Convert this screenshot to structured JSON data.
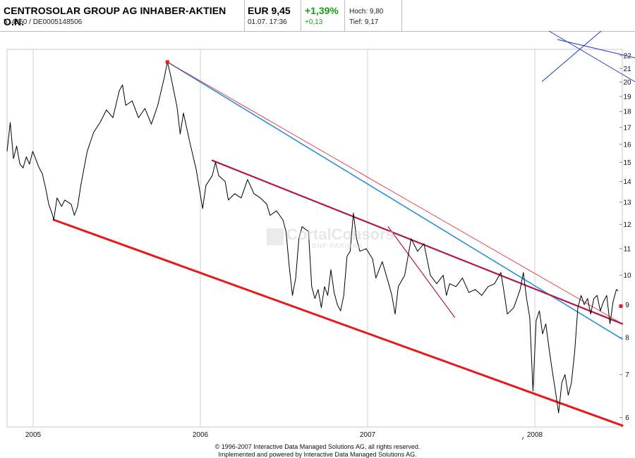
{
  "header": {
    "name": "CENTROSOLAR GROUP AG INHABER-AKTIEN O.N.",
    "ids": "514850  /  DE0005148506",
    "price": "EUR 9,45",
    "time": "01.07.  17:36",
    "change_pct": "+1,39%",
    "change_abs": "+0,13",
    "high": "Hoch: 9,80",
    "low": "Tief: 9,17"
  },
  "watermark": {
    "line1": "CortalConsors",
    "line2": "BNP PARIBAS"
  },
  "footer": {
    "line1": "© 1996-2007 Interactive Data Managed Solutions AG, all rights reserved.",
    "line2": "Implemented and powered by Interactive Data Managed Solutions AG."
  },
  "colors": {
    "price": "#000000",
    "trend_red": "#e8191b",
    "trend_blue": "#2c8ee0",
    "trend_darkred": "#b0184c",
    "corner_blue": "#1c2fd0",
    "positive": "#1a9a1a"
  },
  "chart_data": {
    "type": "line",
    "title": "",
    "xlabel": "",
    "ylabel": "",
    "y_scale": "log",
    "ylim": [
      5.8,
      22.5
    ],
    "xlim": [
      "2004-11-05",
      "2008-07-10"
    ],
    "y_ticks": [
      6,
      7,
      8,
      9,
      10,
      11,
      12,
      13,
      14,
      15,
      16,
      17,
      18,
      19,
      20,
      21,
      22
    ],
    "x_ticks": [
      {
        "date": "2005-01-01",
        "label": "2005"
      },
      {
        "date": "2006-01-01",
        "label": "2006"
      },
      {
        "date": "2007-01-01",
        "label": "2007"
      },
      {
        "date": "2008-01-01",
        "label": "2008"
      }
    ],
    "grid": "vertical",
    "series": [
      {
        "kind": "price",
        "points": [
          [
            "2004-11-05",
            15.6
          ],
          [
            "2004-11-12",
            17.3
          ],
          [
            "2004-11-19",
            15.2
          ],
          [
            "2004-11-26",
            15.9
          ],
          [
            "2004-12-03",
            14.9
          ],
          [
            "2004-12-10",
            14.7
          ],
          [
            "2004-12-17",
            15.3
          ],
          [
            "2004-12-24",
            14.9
          ],
          [
            "2004-12-31",
            15.6
          ],
          [
            "2005-01-14",
            14.7
          ],
          [
            "2005-01-21",
            14.4
          ],
          [
            "2005-01-28",
            13.7
          ],
          [
            "2005-02-04",
            12.9
          ],
          [
            "2005-02-11",
            12.5
          ],
          [
            "2005-02-15",
            12.2
          ],
          [
            "2005-02-22",
            13.2
          ],
          [
            "2005-03-04",
            12.8
          ],
          [
            "2005-03-11",
            13.1
          ],
          [
            "2005-03-25",
            12.9
          ],
          [
            "2005-04-01",
            12.4
          ],
          [
            "2005-04-08",
            12.8
          ],
          [
            "2005-04-15",
            13.8
          ],
          [
            "2005-04-29",
            15.6
          ],
          [
            "2005-05-13",
            16.7
          ],
          [
            "2005-05-27",
            17.3
          ],
          [
            "2005-06-10",
            18.1
          ],
          [
            "2005-06-24",
            17.6
          ],
          [
            "2005-07-08",
            19.4
          ],
          [
            "2005-07-15",
            19.8
          ],
          [
            "2005-07-22",
            18.4
          ],
          [
            "2005-08-05",
            18.7
          ],
          [
            "2005-08-19",
            17.6
          ],
          [
            "2005-09-02",
            18.2
          ],
          [
            "2005-09-16",
            17.2
          ],
          [
            "2005-09-30",
            18.4
          ],
          [
            "2005-10-14",
            20.3
          ],
          [
            "2005-10-21",
            21.5
          ],
          [
            "2005-10-28",
            20.5
          ],
          [
            "2005-11-11",
            18.3
          ],
          [
            "2005-11-18",
            16.6
          ],
          [
            "2005-11-25",
            17.9
          ],
          [
            "2005-12-09",
            16.1
          ],
          [
            "2005-12-23",
            14.6
          ],
          [
            "2006-01-06",
            12.7
          ],
          [
            "2006-01-13",
            13.8
          ],
          [
            "2006-01-27",
            14.3
          ],
          [
            "2006-02-03",
            15.0
          ],
          [
            "2006-02-10",
            14.3
          ],
          [
            "2006-02-24",
            14.0
          ],
          [
            "2006-03-03",
            13.1
          ],
          [
            "2006-03-17",
            13.4
          ],
          [
            "2006-03-31",
            13.2
          ],
          [
            "2006-04-14",
            14.1
          ],
          [
            "2006-04-28",
            13.4
          ],
          [
            "2006-05-12",
            13.2
          ],
          [
            "2006-05-26",
            12.9
          ],
          [
            "2006-06-02",
            12.4
          ],
          [
            "2006-06-16",
            12.6
          ],
          [
            "2006-06-30",
            12.2
          ],
          [
            "2006-07-07",
            11.7
          ],
          [
            "2006-07-14",
            10.3
          ],
          [
            "2006-07-21",
            9.3
          ],
          [
            "2006-07-28",
            9.9
          ],
          [
            "2006-08-04",
            11.4
          ],
          [
            "2006-08-11",
            11.9
          ],
          [
            "2006-08-25",
            11.7
          ],
          [
            "2006-09-01",
            9.6
          ],
          [
            "2006-09-08",
            9.2
          ],
          [
            "2006-09-15",
            9.5
          ],
          [
            "2006-09-22",
            8.9
          ],
          [
            "2006-09-29",
            9.6
          ],
          [
            "2006-10-06",
            9.3
          ],
          [
            "2006-10-13",
            10.2
          ],
          [
            "2006-10-20",
            9.4
          ],
          [
            "2006-10-27",
            9.0
          ],
          [
            "2006-11-03",
            8.8
          ],
          [
            "2006-11-10",
            9.3
          ],
          [
            "2006-11-17",
            10.7
          ],
          [
            "2006-11-24",
            10.9
          ],
          [
            "2006-12-01",
            12.5
          ],
          [
            "2006-12-08",
            11.4
          ],
          [
            "2006-12-15",
            10.9
          ],
          [
            "2006-12-29",
            11.0
          ],
          [
            "2007-01-12",
            10.6
          ],
          [
            "2007-01-19",
            9.9
          ],
          [
            "2007-02-02",
            10.5
          ],
          [
            "2007-02-16",
            9.7
          ],
          [
            "2007-02-23",
            9.3
          ],
          [
            "2007-03-02",
            8.7
          ],
          [
            "2007-03-09",
            9.6
          ],
          [
            "2007-03-23",
            10.0
          ],
          [
            "2007-04-06",
            11.4
          ],
          [
            "2007-04-20",
            10.9
          ],
          [
            "2007-05-04",
            11.2
          ],
          [
            "2007-05-18",
            10.0
          ],
          [
            "2007-06-01",
            9.7
          ],
          [
            "2007-06-15",
            10.0
          ],
          [
            "2007-06-22",
            9.3
          ],
          [
            "2007-06-29",
            9.7
          ],
          [
            "2007-07-13",
            9.6
          ],
          [
            "2007-07-27",
            9.9
          ],
          [
            "2007-08-10",
            9.4
          ],
          [
            "2007-08-24",
            9.5
          ],
          [
            "2007-09-07",
            9.3
          ],
          [
            "2007-09-21",
            9.6
          ],
          [
            "2007-10-05",
            9.7
          ],
          [
            "2007-10-19",
            10.1
          ],
          [
            "2007-10-26",
            9.4
          ],
          [
            "2007-11-02",
            8.7
          ],
          [
            "2007-11-16",
            8.9
          ],
          [
            "2007-11-30",
            9.5
          ],
          [
            "2007-12-07",
            10.1
          ],
          [
            "2007-12-14",
            9.2
          ],
          [
            "2007-12-21",
            8.6
          ],
          [
            "2007-12-28",
            6.6
          ],
          [
            "2008-01-04",
            8.5
          ],
          [
            "2008-01-11",
            8.8
          ],
          [
            "2008-01-18",
            8.1
          ],
          [
            "2008-01-25",
            8.4
          ],
          [
            "2008-02-01",
            7.7
          ],
          [
            "2008-02-08",
            7.1
          ],
          [
            "2008-02-15",
            6.6
          ],
          [
            "2008-02-22",
            6.1
          ],
          [
            "2008-02-29",
            6.8
          ],
          [
            "2008-03-07",
            7.0
          ],
          [
            "2008-03-14",
            6.5
          ],
          [
            "2008-03-21",
            6.8
          ],
          [
            "2008-03-28",
            7.6
          ],
          [
            "2008-04-04",
            8.9
          ],
          [
            "2008-04-11",
            9.3
          ],
          [
            "2008-04-18",
            9.0
          ],
          [
            "2008-04-25",
            9.2
          ],
          [
            "2008-05-02",
            8.7
          ],
          [
            "2008-05-09",
            9.2
          ],
          [
            "2008-05-16",
            9.3
          ],
          [
            "2008-05-23",
            8.8
          ],
          [
            "2008-05-30",
            9.1
          ],
          [
            "2008-06-06",
            9.3
          ],
          [
            "2008-06-13",
            8.4
          ],
          [
            "2008-06-20",
            9.1
          ],
          [
            "2008-06-27",
            9.5
          ],
          [
            "2008-07-01",
            9.45
          ]
        ]
      }
    ],
    "trendlines": [
      {
        "from": [
          "2005-02-15",
          12.2
        ],
        "to": [
          "2008-07-10",
          5.83
        ],
        "color": "trend_red",
        "width": 3
      },
      {
        "from": [
          "2005-10-21",
          21.5
        ],
        "to": [
          "2008-07-10",
          7.95
        ],
        "color": "trend_blue",
        "width": 1.6
      },
      {
        "from": [
          "2005-10-21",
          21.5
        ],
        "to": [
          "2008-07-10",
          8.4
        ],
        "color": "trend_red",
        "width": 0.8
      },
      {
        "from": [
          "2006-01-27",
          15.1
        ],
        "to": [
          "2008-07-10",
          8.4
        ],
        "color": "trend_darkred",
        "width": 2.2
      },
      {
        "from": [
          "2007-02-15",
          11.9
        ],
        "to": [
          "2007-07-10",
          8.6
        ],
        "color": "trend_darkred",
        "width": 1.2
      }
    ],
    "markers": [
      {
        "date": "2005-10-21",
        "value": 21.5,
        "color": "trend_red"
      },
      {
        "date": "2008-07-07",
        "value": 8.95,
        "color": "trend_red"
      }
    ]
  }
}
